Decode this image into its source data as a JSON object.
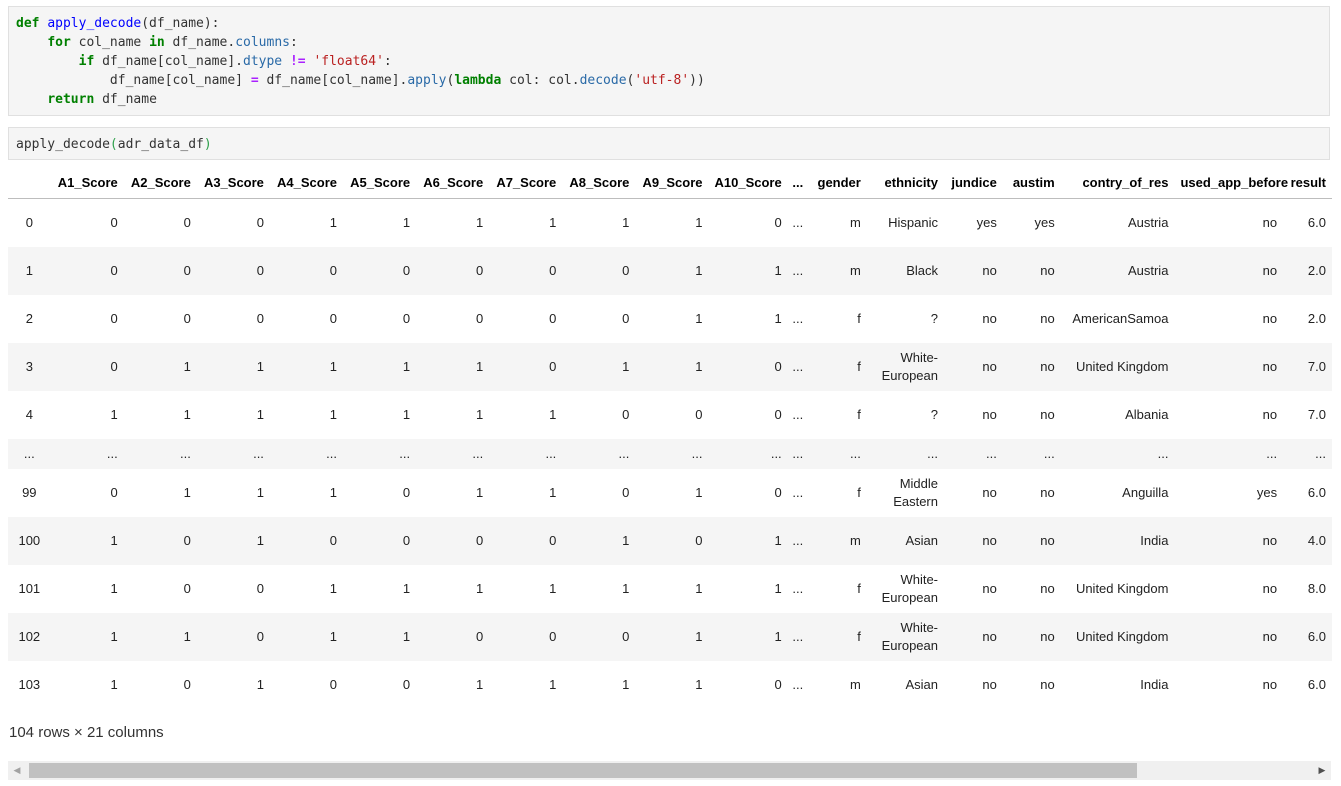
{
  "code_cells": [
    {
      "lines": [
        [
          {
            "t": "def",
            "c": "kw"
          },
          {
            "t": " ",
            "c": "plain"
          },
          {
            "t": "apply_decode",
            "c": "fn"
          },
          {
            "t": "(df_name):",
            "c": "plain"
          }
        ],
        [
          {
            "t": "    ",
            "c": "plain"
          },
          {
            "t": "for",
            "c": "kw"
          },
          {
            "t": " col_name ",
            "c": "plain"
          },
          {
            "t": "in",
            "c": "kw"
          },
          {
            "t": " df_name.",
            "c": "plain"
          },
          {
            "t": "columns",
            "c": "attr"
          },
          {
            "t": ":",
            "c": "plain"
          }
        ],
        [
          {
            "t": "        ",
            "c": "plain"
          },
          {
            "t": "if",
            "c": "kw"
          },
          {
            "t": " df_name[col_name].",
            "c": "plain"
          },
          {
            "t": "dtype",
            "c": "attr"
          },
          {
            "t": " ",
            "c": "plain"
          },
          {
            "t": "!=",
            "c": "op"
          },
          {
            "t": " ",
            "c": "plain"
          },
          {
            "t": "'float64'",
            "c": "str"
          },
          {
            "t": ":",
            "c": "plain"
          }
        ],
        [
          {
            "t": "            df_name[col_name] ",
            "c": "plain"
          },
          {
            "t": "=",
            "c": "op"
          },
          {
            "t": " df_name[col_name].",
            "c": "plain"
          },
          {
            "t": "apply",
            "c": "attr"
          },
          {
            "t": "(",
            "c": "plain"
          },
          {
            "t": "lambda",
            "c": "kw"
          },
          {
            "t": " col: col.",
            "c": "plain"
          },
          {
            "t": "decode",
            "c": "attr"
          },
          {
            "t": "(",
            "c": "plain"
          },
          {
            "t": "'utf-8'",
            "c": "str"
          },
          {
            "t": "))",
            "c": "plain"
          }
        ],
        [
          {
            "t": "    ",
            "c": "plain"
          },
          {
            "t": "return",
            "c": "kw"
          },
          {
            "t": " df_name",
            "c": "plain"
          }
        ]
      ]
    },
    {
      "lines": [
        [
          {
            "t": "apply_decode",
            "c": "plain"
          },
          {
            "t": "(",
            "c": "paren"
          },
          {
            "t": "adr_data_df",
            "c": "plain"
          },
          {
            "t": ")",
            "c": "paren"
          }
        ]
      ]
    }
  ],
  "dataframe": {
    "columns": [
      "",
      "A1_Score",
      "A2_Score",
      "A3_Score",
      "A4_Score",
      "A5_Score",
      "A6_Score",
      "A7_Score",
      "A8_Score",
      "A9_Score",
      "A10_Score",
      "...",
      "gender",
      "ethnicity",
      "jundice",
      "austim",
      "contry_of_res",
      "used_app_before",
      "result"
    ],
    "rows": [
      [
        "0",
        "0",
        "0",
        "0",
        "1",
        "1",
        "1",
        "1",
        "1",
        "1",
        "0",
        "...",
        "m",
        "Hispanic",
        "yes",
        "yes",
        "Austria",
        "no",
        "6.0"
      ],
      [
        "1",
        "0",
        "0",
        "0",
        "0",
        "0",
        "0",
        "0",
        "0",
        "1",
        "1",
        "...",
        "m",
        "Black",
        "no",
        "no",
        "Austria",
        "no",
        "2.0"
      ],
      [
        "2",
        "0",
        "0",
        "0",
        "0",
        "0",
        "0",
        "0",
        "0",
        "1",
        "1",
        "...",
        "f",
        "?",
        "no",
        "no",
        "AmericanSamoa",
        "no",
        "2.0"
      ],
      [
        "3",
        "0",
        "1",
        "1",
        "1",
        "1",
        "1",
        "0",
        "1",
        "1",
        "0",
        "...",
        "f",
        "White-European",
        "no",
        "no",
        "United Kingdom",
        "no",
        "7.0"
      ],
      [
        "4",
        "1",
        "1",
        "1",
        "1",
        "1",
        "1",
        "1",
        "0",
        "0",
        "0",
        "...",
        "f",
        "?",
        "no",
        "no",
        "Albania",
        "no",
        "7.0"
      ],
      [
        "...",
        "...",
        "...",
        "...",
        "...",
        "...",
        "...",
        "...",
        "...",
        "...",
        "...",
        "...",
        "...",
        "...",
        "...",
        "...",
        "...",
        "...",
        "..."
      ],
      [
        "99",
        "0",
        "1",
        "1",
        "1",
        "0",
        "1",
        "1",
        "0",
        "1",
        "0",
        "...",
        "f",
        "Middle Eastern",
        "no",
        "no",
        "Anguilla",
        "yes",
        "6.0"
      ],
      [
        "100",
        "1",
        "0",
        "1",
        "0",
        "0",
        "0",
        "0",
        "1",
        "0",
        "1",
        "...",
        "m",
        "Asian",
        "no",
        "no",
        "India",
        "no",
        "4.0"
      ],
      [
        "101",
        "1",
        "0",
        "0",
        "1",
        "1",
        "1",
        "1",
        "1",
        "1",
        "1",
        "...",
        "f",
        "White-European",
        "no",
        "no",
        "United Kingdom",
        "no",
        "8.0"
      ],
      [
        "102",
        "1",
        "1",
        "0",
        "1",
        "1",
        "0",
        "0",
        "0",
        "1",
        "1",
        "...",
        "f",
        "White-European",
        "no",
        "no",
        "United Kingdom",
        "no",
        "6.0"
      ],
      [
        "103",
        "1",
        "0",
        "1",
        "0",
        "0",
        "1",
        "1",
        "1",
        "1",
        "0",
        "...",
        "m",
        "Asian",
        "no",
        "no",
        "India",
        "no",
        "6.0"
      ]
    ],
    "shape_label": "104 rows × 21 columns"
  },
  "scrollbar": {
    "left_arrow_icon": "◀",
    "right_arrow_icon": "▶",
    "thumb_fraction": 0.84
  }
}
